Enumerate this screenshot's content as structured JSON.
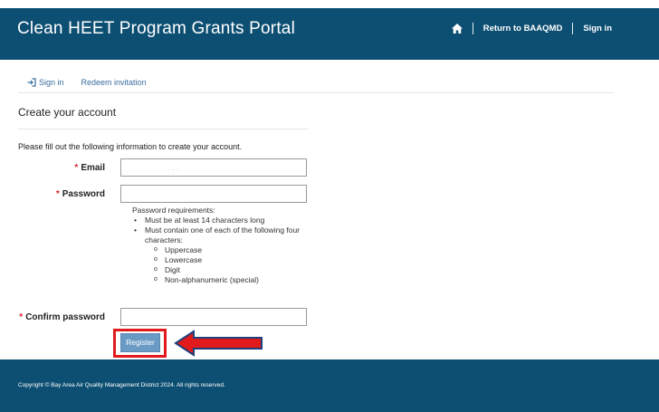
{
  "header": {
    "title": "Clean HEET Program Grants Portal",
    "nav": {
      "home_icon": "home-icon",
      "return_label": "Return to BAAQMD",
      "signin_label": "Sign in"
    },
    "color": "#0d4f73"
  },
  "tabs": [
    {
      "label": "Sign in",
      "icon": "sign-in-icon"
    },
    {
      "label": "Redeem invitation"
    }
  ],
  "form": {
    "title": "Create your account",
    "intro": "Please fill out the following information to create your account.",
    "required_marker": "*",
    "email": {
      "label": "Email",
      "value": ". . ."
    },
    "password": {
      "label": "Password",
      "value": ""
    },
    "requirements": {
      "heading": "Password requirements:",
      "items": [
        "Must be at least 14 characters long",
        "Must contain one of each of the following four characters:"
      ],
      "sub_items": [
        "Uppercase",
        "Lowercase",
        "Digit",
        "Non-alphanumeric (special)"
      ]
    },
    "confirm_password": {
      "label": "Confirm password",
      "value": ""
    },
    "register_label": "Register",
    "register_color": "#6a9bc5"
  },
  "annotation": {
    "highlight_color": "#e11b1b",
    "arrow_fill": "#e11b1b",
    "arrow_outline": "#1f3f7a"
  },
  "footer": {
    "copyright": "Copyright © Bay Area Air Quality Management District 2024. All rights reserved."
  }
}
